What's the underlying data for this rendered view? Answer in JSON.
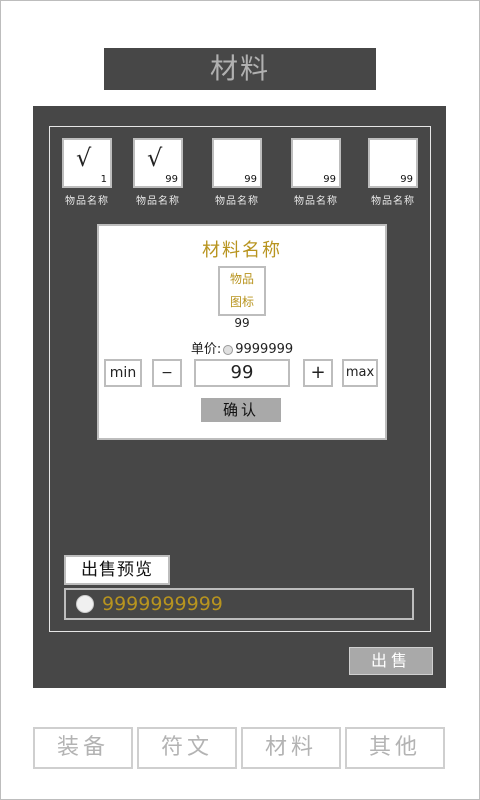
{
  "title": "材料",
  "slots": [
    {
      "checked": true,
      "mark": "√",
      "count": "1",
      "label": "物品名称"
    },
    {
      "checked": true,
      "mark": "√",
      "count": "99",
      "label": "物品名称"
    },
    {
      "checked": false,
      "mark": "",
      "count": "99",
      "label": "物品名称"
    },
    {
      "checked": false,
      "mark": "",
      "count": "99",
      "label": "物品名称"
    },
    {
      "checked": false,
      "mark": "",
      "count": "99",
      "label": "物品名称"
    }
  ],
  "dialog": {
    "title": "材料名称",
    "icon_line1": "物品",
    "icon_line2": "图标",
    "count": "99",
    "price_label": "单价:",
    "price_value": "9999999",
    "min_label": "min",
    "minus_label": "−",
    "quantity": "99",
    "plus_label": "+",
    "max_label": "max",
    "confirm_label": "确认"
  },
  "preview_label": "出售预览",
  "total_value": "9999999999",
  "sell_label": "出售",
  "tabs": [
    {
      "label": "装备"
    },
    {
      "label": "符文"
    },
    {
      "label": "材料"
    },
    {
      "label": "其他"
    }
  ],
  "colors": {
    "panel": "#474747",
    "gold": "#b8941f",
    "button_gray": "#a9a9a9",
    "border": "#bdbdbd"
  }
}
